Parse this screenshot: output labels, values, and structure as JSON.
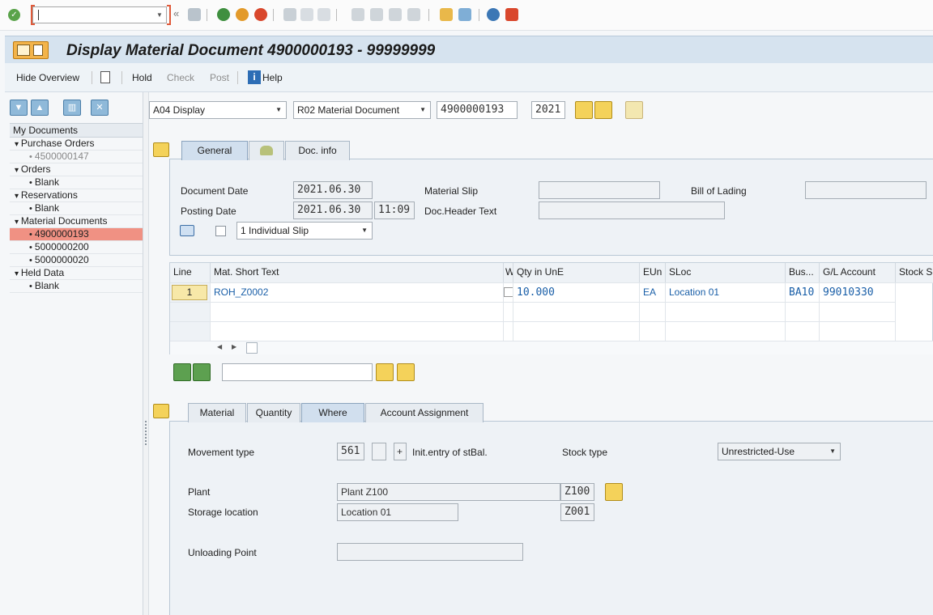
{
  "window": {
    "title": "Display Material Document 4900000193 - 99999999"
  },
  "toolbar": {
    "command_field": "",
    "icons": [
      "enter-icon",
      "back-icon",
      "save-icon",
      "back-green-icon",
      "exit-icon",
      "cancel-icon",
      "print-icon",
      "find-icon",
      "find-next-icon",
      "first-page-icon",
      "prev-page-icon",
      "next-page-icon",
      "last-page-icon",
      "new-session-icon",
      "shortcut-icon",
      "help-icon",
      "layout-icon"
    ]
  },
  "appbar": {
    "hide_overview": "Hide Overview",
    "hold": "Hold",
    "check": "Check",
    "post": "Post",
    "help": "Help"
  },
  "tree": {
    "header": "My Documents",
    "nodes": [
      {
        "type": "group",
        "label": "Purchase Orders"
      },
      {
        "type": "leaf",
        "label": "4500000147",
        "style": "gray"
      },
      {
        "type": "group",
        "label": "Orders"
      },
      {
        "type": "leaf",
        "label": "Blank"
      },
      {
        "type": "group",
        "label": "Reservations"
      },
      {
        "type": "leaf",
        "label": "Blank"
      },
      {
        "type": "group",
        "label": "Material Documents"
      },
      {
        "type": "leaf",
        "label": "4900000193",
        "style": "selected"
      },
      {
        "type": "leaf",
        "label": "5000000200"
      },
      {
        "type": "leaf",
        "label": "5000000020"
      },
      {
        "type": "group",
        "label": "Held Data"
      },
      {
        "type": "leaf",
        "label": "Blank"
      }
    ]
  },
  "header_row": {
    "action": "A04 Display",
    "ref_doc": "R02 Material Document",
    "doc_number": "4900000193",
    "doc_year": "2021"
  },
  "header_tabs": [
    "General",
    "",
    "Doc. info"
  ],
  "general": {
    "doc_date_label": "Document Date",
    "doc_date": "2021.06.30",
    "material_slip_label": "Material Slip",
    "material_slip": "",
    "bill_of_lading_label": "Bill of Lading",
    "bill_of_lading": "",
    "posting_date_label": "Posting Date",
    "posting_date": "2021.06.30",
    "posting_time": "11:09",
    "doc_header_text_label": "Doc.Header Text",
    "doc_header_text": "",
    "print_version": "1 Individual Slip"
  },
  "items": {
    "columns": [
      "Line",
      "Mat. Short Text",
      "W",
      "Qty in UnE",
      "EUn",
      "SLoc",
      "Bus...",
      "G/L Account",
      "Stock S"
    ],
    "rows": [
      {
        "line": "1",
        "mat_short_text": "ROH_Z0002",
        "w": "",
        "qty": "10.000",
        "eun": "EA",
        "sloc": "Location 01",
        "bus": "BA10",
        "gl": "99010330",
        "stock": ""
      }
    ]
  },
  "detail_tabs": [
    "Material",
    "Quantity",
    "Where",
    "Account Assignment"
  ],
  "where": {
    "movement_type_label": "Movement type",
    "movement_type": "561",
    "plus": "+",
    "init_entry_label": "Init.entry of stBal.",
    "stock_type_label": "Stock type",
    "stock_type": "Unrestricted-Use",
    "plant_label": "Plant",
    "plant_name": "Plant Z100",
    "plant_code": "Z100",
    "storage_location_label": "Storage location",
    "storage_location_name": "Location 01",
    "storage_location_code": "Z001",
    "unloading_point_label": "Unloading Point",
    "unloading_point": ""
  },
  "colors": {
    "accent": "#f09183",
    "link": "#1a5fa8",
    "title_bar": "#d6e3ef"
  }
}
